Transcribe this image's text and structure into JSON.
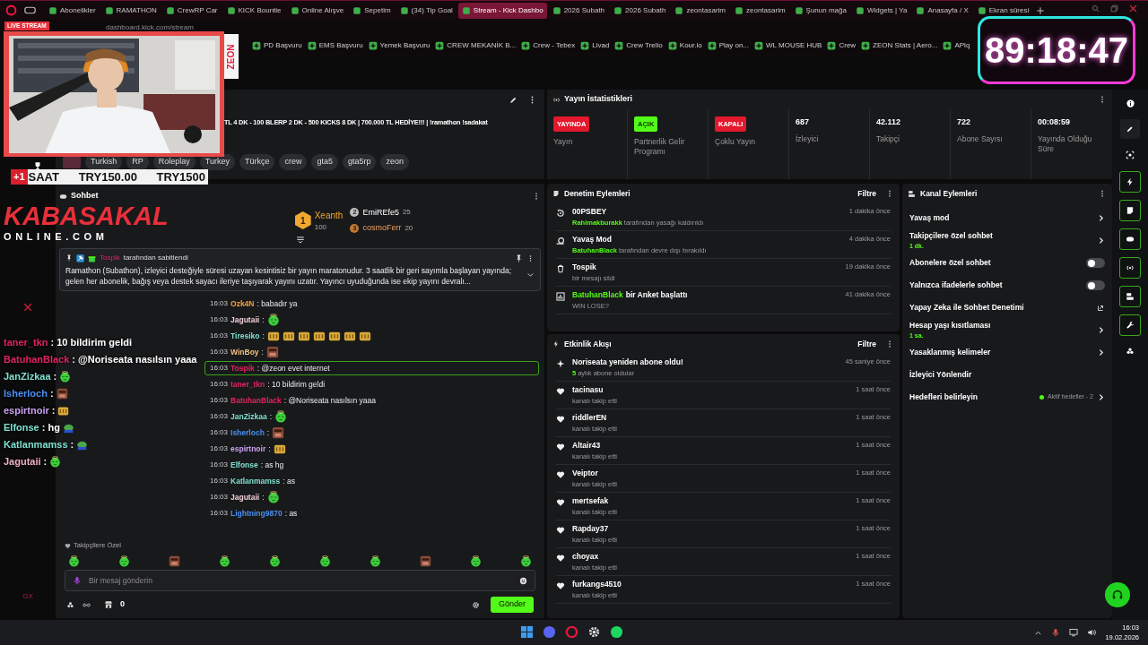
{
  "browser": {
    "tabs": [
      {
        "label": "Abonelikler",
        "selected": false
      },
      {
        "label": "RAMATHON",
        "selected": false
      },
      {
        "label": "CrewRP Car",
        "selected": false
      },
      {
        "label": "KICK Bountie",
        "selected": false
      },
      {
        "label": "Online Alışve",
        "selected": false
      },
      {
        "label": "Sepetim",
        "selected": false
      },
      {
        "label": "(34) Tip Goal",
        "selected": false
      },
      {
        "label": "Stream - Kick Dashbo",
        "selected": true
      },
      {
        "label": "2026 Subath",
        "selected": false
      },
      {
        "label": "2026 Subath",
        "selected": false
      },
      {
        "label": "zeontasarim",
        "selected": false
      },
      {
        "label": "zeontasarim",
        "selected": false
      },
      {
        "label": "Şunun mağa",
        "selected": false
      },
      {
        "label": "Widgets | Ya",
        "selected": false
      },
      {
        "label": "Anasayfa / X",
        "selected": false
      },
      {
        "label": "Ekran süresi",
        "selected": false
      }
    ],
    "address": "dashboard.kick.com/stream",
    "bookmarks": [
      "PD Başvuru",
      "EMS Başvuru",
      "Yemek Başvuru",
      "CREW MEKANİK B...",
      "Crew - Tebex",
      "Livad",
      "Crew Trello",
      "Kour.io",
      "Play on...",
      "WL MOUSE HUB",
      "Crew",
      "ZEON Stats | Aero...",
      "APlq"
    ],
    "sidebar_label": "GX"
  },
  "overlay": {
    "live_label": "LIVE STREAM",
    "side_text": "ZEON",
    "timer": "89:18:47",
    "sale_bar": {
      "badge": "+1",
      "unit": "SAAT",
      "price": "TRY150.00",
      "total": "TRY1500"
    },
    "logo": {
      "title": "KABASAKAL",
      "subtitle": "ONLINE.COM"
    },
    "chat": [
      {
        "kind": "text",
        "name": "taner_tkn",
        "color": "#e0245e",
        "text": ": 10 bildirim geldi"
      },
      {
        "kind": "text",
        "name": "BatuhanBlack",
        "color": "#e0245e",
        "text": ": @Noriseata nasılsın yaaa"
      },
      {
        "kind": "blob",
        "name": "JanZizkaa",
        "color": "#7fe0d0",
        "text": ":"
      },
      {
        "kind": "face",
        "name": "Isherloch",
        "color": "#4a8ff0",
        "text": ":"
      },
      {
        "kind": "gold",
        "name": "espirtnoir",
        "color": "#c9a0f0",
        "text": ":"
      },
      {
        "kind": "frog",
        "name": "Elfonse",
        "color": "#7fe0d0",
        "text": ": hg"
      },
      {
        "kind": "frog",
        "name": "Katlanmamss",
        "color": "#7fe0d0",
        "text": ":"
      },
      {
        "kind": "blob",
        "name": "Jagutaii",
        "color": "#f0b0c8",
        "text": ":"
      }
    ]
  },
  "stream_info": {
    "title": "TL 4 DK - 100 BLERP 2 DK - 500 KICKS 8 DK | 700.000 TL HEDİYE!!! | !ramathon !sadakat",
    "tags": [
      "Turkish",
      "RP",
      "Roleplay",
      "Turkey",
      "Türkçe",
      "crew",
      "gta5",
      "gta5rp",
      "zeon"
    ]
  },
  "chat": {
    "title": "Sohbet",
    "leaderboard": [
      {
        "rank": "1",
        "name": "Xeanth",
        "amount": "100"
      },
      {
        "rank": "2",
        "name": "EmiREfe5",
        "amount": "25"
      },
      {
        "rank": "3",
        "name": "cosmoFerr",
        "amount": "20"
      }
    ],
    "pinned": {
      "by": "Tospik",
      "note": "tarafından sabitlendi",
      "text": "Ramathon (Subathon), izleyici desteğiyle süresi uzayan kesintisiz bir yayın maratonudur. 3 saatlik bir geri sayımla başlayan yayında; gelen her abonelik, bağış veya destek sayacı ileriye taşıyarak yayını uzatır. Yayıncı uyuduğunda ise ekip yayını devralı..."
    },
    "messages": [
      {
        "kind": "text",
        "time": "16:03",
        "name": "Ozk4N",
        "color": "#f0a040",
        "text": ": babadır ya",
        "highlighted": false
      },
      {
        "kind": "blob",
        "time": "16:03",
        "name": "Jagutaii",
        "color": "#f0d0d8",
        "text": ":",
        "highlighted": false
      },
      {
        "kind": "gold_row",
        "time": "16:03",
        "name": "Tiresiko",
        "color": "#7fe0d0",
        "text": ":",
        "highlighted": false
      },
      {
        "kind": "face",
        "time": "16:03",
        "name": "WinBoy",
        "color": "#f0c080",
        "text": ":",
        "highlighted": false
      },
      {
        "kind": "text",
        "time": "16:03",
        "name": "Tospik",
        "color": "#e0245e",
        "text": ": @zeon evet internet",
        "highlighted": true
      },
      {
        "kind": "text",
        "time": "16:03",
        "name": "taner_tkn",
        "color": "#e0245e",
        "text": ": 10 bildirim geldi",
        "highlighted": false
      },
      {
        "kind": "text",
        "time": "16:03",
        "name": "BatuhanBlack",
        "color": "#e0245e",
        "text": ": @Noriseata nasılsın yaaa",
        "highlighted": false
      },
      {
        "kind": "blob",
        "time": "16:03",
        "name": "JanZizkaa",
        "color": "#7fe0d0",
        "text": ":",
        "highlighted": false
      },
      {
        "kind": "face",
        "time": "16:03",
        "name": "Isherloch",
        "color": "#4a8ff0",
        "text": ":",
        "highlighted": false
      },
      {
        "kind": "gold",
        "time": "16:03",
        "name": "espirtnoir",
        "color": "#c9a0f0",
        "text": ":",
        "highlighted": false
      },
      {
        "kind": "text",
        "time": "16:03",
        "name": "Elfonse",
        "color": "#7fe0d0",
        "text": ": as hg",
        "highlighted": false
      },
      {
        "kind": "text",
        "time": "16:03",
        "name": "Katlanmamss",
        "color": "#7fe0d0",
        "text": ": as",
        "highlighted": false
      },
      {
        "kind": "blob",
        "time": "16:03",
        "name": "Jagutaii",
        "color": "#f0d0d8",
        "text": ":",
        "highlighted": false
      },
      {
        "kind": "text",
        "time": "16:03",
        "name": "Lightning9870",
        "color": "#4a8ff0",
        "text": ": as",
        "highlighted": false
      }
    ],
    "emote_section": "Takipçilere Özel",
    "emote_bar": [
      {
        "kind": "blob"
      },
      {
        "kind": "blob"
      },
      {
        "kind": "face"
      },
      {
        "kind": "blob"
      },
      {
        "kind": "blob"
      },
      {
        "kind": "blob"
      },
      {
        "kind": "blob"
      },
      {
        "kind": "face"
      },
      {
        "kind": "blob"
      },
      {
        "kind": "blob"
      }
    ],
    "placeholder": "Bir mesaj gönderin",
    "points": "0",
    "send": "Gönder"
  },
  "stats": {
    "title": "Yayın İstatistikleri",
    "items": [
      {
        "kind": "badge",
        "badge": "YAYINDA",
        "color": "#e3182d",
        "label": "Yayın"
      },
      {
        "kind": "badge",
        "badge": "AÇIK",
        "color": "#53fc18",
        "label": "Partnerlik Gelir Programı"
      },
      {
        "kind": "badge",
        "badge": "KAPALI",
        "color": "#e3182d",
        "label": "Çoklu Yayın"
      },
      {
        "kind": "value",
        "value": "687",
        "label": "İzleyici"
      },
      {
        "kind": "value",
        "value": "42.112",
        "label": "Takipçi"
      },
      {
        "kind": "value",
        "value": "722",
        "label": "Abone Sayısı"
      },
      {
        "kind": "value",
        "value": "00:08:59",
        "label": "Yayında Olduğu Süre"
      }
    ]
  },
  "moderation": {
    "title": "Denetim Eylemleri",
    "filter": "Filtre",
    "items": [
      {
        "kind": "unban",
        "title": "00PSBEY",
        "actor": "Rahimakburakk",
        "detail": "tarafından yasağı kaldırıldı",
        "time": "1 dakika önce"
      },
      {
        "kind": "slow",
        "title": "Yavaş Mod",
        "actor": "BatuhanBlack",
        "detail": "tarafından devre dışı bırakıldı",
        "time": "4 dakika önce"
      },
      {
        "kind": "delete",
        "title": "Tospik",
        "detail": "bir mesajı sildi",
        "time": "19 dakika önce"
      },
      {
        "kind": "poll",
        "title_actor": "BatuhanBlack",
        "title": "bir Anket başlattı",
        "detail": "WIN LOSE?",
        "time": "41 dakika önce"
      }
    ]
  },
  "activity": {
    "title": "Etkinlik Akışı",
    "filter": "Filtre",
    "items": [
      {
        "kind": "resub",
        "title": "Noriseata yeniden abone oldu!",
        "count": "5",
        "detail": "aylık abone oldular",
        "time": "45 saniye önce"
      },
      {
        "kind": "follow",
        "title": "tacinasu",
        "detail": "kanalı takip etti",
        "time": "1 saat önce"
      },
      {
        "kind": "follow",
        "title": "riddlerEN",
        "detail": "kanalı takip etti",
        "time": "1 saat önce"
      },
      {
        "kind": "follow",
        "title": "Altair43",
        "detail": "kanalı takip etti",
        "time": "1 saat önce"
      },
      {
        "kind": "follow",
        "title": "Veiptor",
        "detail": "kanalı takip etti",
        "time": "1 saat önce"
      },
      {
        "kind": "follow",
        "title": "mertsefak",
        "detail": "kanalı takip etti",
        "time": "1 saat önce"
      },
      {
        "kind": "follow",
        "title": "Rapday37",
        "detail": "kanalı takip etti",
        "time": "1 saat önce"
      },
      {
        "kind": "follow",
        "title": "choyax",
        "detail": "kanalı takip etti",
        "time": "1 saat önce"
      },
      {
        "kind": "follow",
        "title": "furkangs4510",
        "detail": "kanalı takip etti",
        "time": "1 saat önce"
      }
    ]
  },
  "channel_actions": {
    "title": "Kanal Eylemleri",
    "items": [
      {
        "kind": "link",
        "label": "Yavaş mod"
      },
      {
        "kind": "link",
        "label": "Takipçilere özel sohbet",
        "value": "1 dk."
      },
      {
        "kind": "toggle",
        "label": "Abonelere özel sohbet",
        "on": false
      },
      {
        "kind": "toggle",
        "label": "Yalnızca ifadelerle sohbet",
        "on": false
      },
      {
        "kind": "external",
        "label": "Yapay Zeka ile Sohbet Denetimi"
      },
      {
        "kind": "link",
        "label": "Hesap yaşı kısıtlaması",
        "value": "1 sa."
      },
      {
        "kind": "link",
        "label": "Yasaklanmış kelimeler"
      },
      {
        "kind": "plain",
        "label": "İzleyici Yönlendir"
      },
      {
        "kind": "link",
        "label": "Hedefleri belirleyin",
        "status": "Aktif hedefler - 2"
      }
    ]
  },
  "taskbar": {
    "time": "16:03",
    "date": "19.02.2026"
  }
}
